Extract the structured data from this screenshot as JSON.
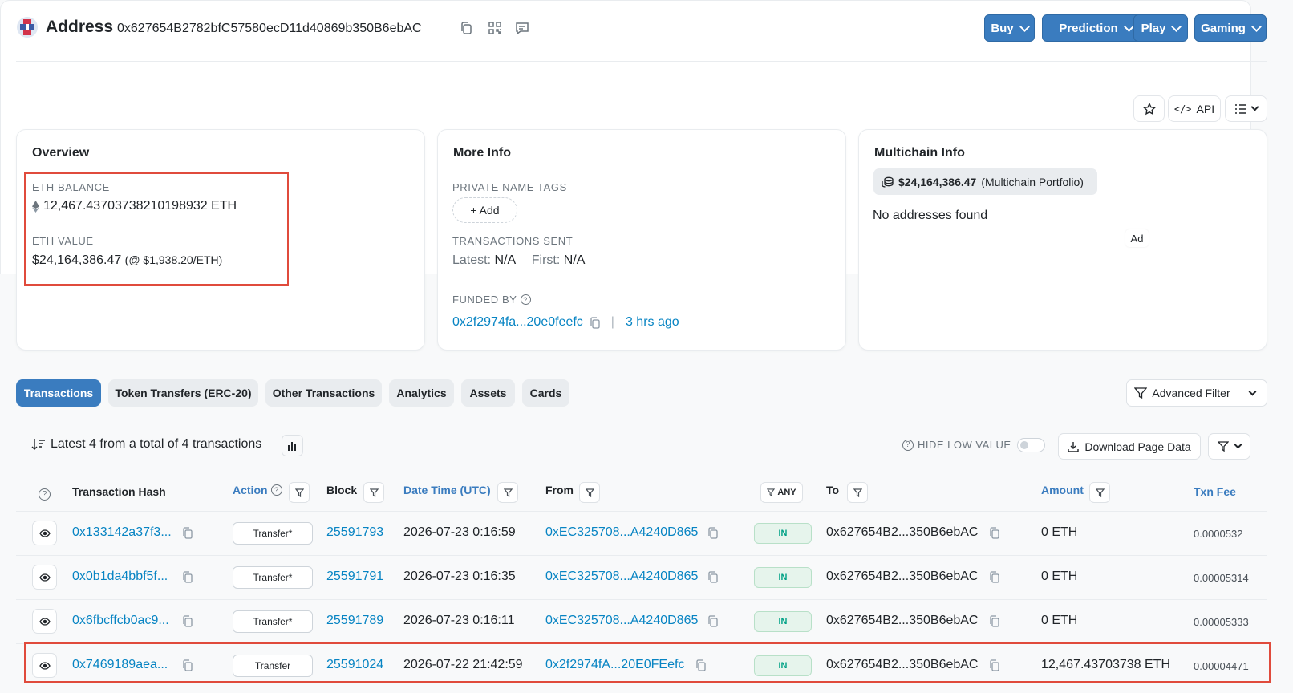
{
  "header": {
    "title": "Address",
    "address": "0x627654B2782bfC57580ecD11d40869b350B6ebAC",
    "icons": [
      "copy-icon",
      "qr-code-icon",
      "comment-icon"
    ],
    "buttons": [
      "Buy",
      "Prediction",
      "Play",
      "Gaming"
    ]
  },
  "toolbar": {
    "api_label": "API"
  },
  "overview": {
    "title": "Overview",
    "eth_balance_label": "ETH BALANCE",
    "eth_balance": "12,467.43703738210198932 ETH",
    "eth_value_label": "ETH VALUE",
    "eth_value": "$24,164,386.47",
    "eth_price": "(@ $1,938.20/ETH)"
  },
  "more_info": {
    "title": "More Info",
    "private_tags_label": "PRIVATE NAME TAGS",
    "add_label": "+ Add",
    "tx_sent_label": "TRANSACTIONS SENT",
    "latest_label": "Latest:",
    "latest_value": "N/A",
    "first_label": "First:",
    "first_value": "N/A",
    "funded_by_label": "FUNDED BY",
    "funded_by_address": "0x2f2974fa...20e0feefc",
    "funded_separator": "|",
    "funded_time": "3 hrs ago"
  },
  "multichain": {
    "title": "Multichain Info",
    "portfolio_value": "$24,164,386.47",
    "portfolio_suffix": "(Multichain Portfolio)",
    "no_addresses": "No addresses found",
    "ad_label": "Ad"
  },
  "tabs": [
    "Transactions",
    "Token Transfers (ERC-20)",
    "Other Transactions",
    "Analytics",
    "Assets",
    "Cards"
  ],
  "advanced_filter_label": "Advanced Filter",
  "table": {
    "summary": "Latest 4 from a total of 4 transactions",
    "hide_low_value_label": "HIDE LOW VALUE",
    "download_label": "Download Page Data",
    "any_label": "ANY",
    "headers": {
      "hash": "Transaction Hash",
      "action": "Action",
      "block": "Block",
      "datetime": "Date Time (UTC)",
      "from": "From",
      "to": "To",
      "amount": "Amount",
      "fee": "Txn Fee"
    },
    "rows": [
      {
        "hash": "0x133142a37f3...",
        "action": "Transfer*",
        "block": "25591793",
        "datetime": "2026-07-23 0:16:59",
        "from": "0xEC325708...A4240D865",
        "direction": "IN",
        "to": "0x627654B2...350B6ebAC",
        "amount": "0 ETH",
        "fee": "0.0000532"
      },
      {
        "hash": "0x0b1da4bbf5f...",
        "action": "Transfer*",
        "block": "25591791",
        "datetime": "2026-07-23 0:16:35",
        "from": "0xEC325708...A4240D865",
        "direction": "IN",
        "to": "0x627654B2...350B6ebAC",
        "amount": "0 ETH",
        "fee": "0.00005314"
      },
      {
        "hash": "0x6fbcffcb0ac9...",
        "action": "Transfer*",
        "block": "25591789",
        "datetime": "2026-07-23 0:16:11",
        "from": "0xEC325708...A4240D865",
        "direction": "IN",
        "to": "0x627654B2...350B6ebAC",
        "amount": "0 ETH",
        "fee": "0.00005333"
      },
      {
        "hash": "0x7469189aea...",
        "action": "Transfer",
        "block": "25591024",
        "datetime": "2026-07-22 21:42:59",
        "from": "0x2f2974fA...20E0FEefc",
        "direction": "IN",
        "to": "0x627654B2...350B6ebAC",
        "amount": "12,467.43703738 ETH",
        "fee": "0.00004471"
      }
    ]
  },
  "colors": {
    "primary": "#3a7cbf",
    "link": "#0784c3",
    "highlight": "#e04b3c",
    "in_badge": "#00a186"
  }
}
